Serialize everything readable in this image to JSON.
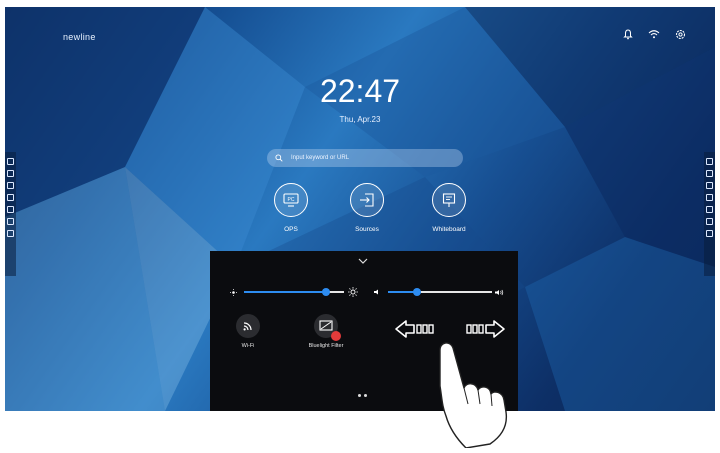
{
  "brand": {
    "logo": "newline"
  },
  "status_bar": {
    "icons": [
      "bell-icon",
      "wifi-icon",
      "settings-icon"
    ]
  },
  "clock": {
    "time": "22:47",
    "date": "Thu, Apr.23"
  },
  "search": {
    "placeholder": "Input keyword or URL"
  },
  "apps": [
    {
      "label": "OPS",
      "icon": "pc-icon"
    },
    {
      "label": "Sources",
      "icon": "source-input-icon"
    },
    {
      "label": "Whiteboard",
      "icon": "whiteboard-icon"
    }
  ],
  "sidebar": {
    "icons": [
      "home-icon",
      "annotate-icon",
      "screenshot-icon",
      "windows-icon",
      "back-icon",
      "apps-icon",
      "multitask-icon"
    ]
  },
  "control_panel": {
    "brightness": {
      "level": 0.82
    },
    "volume": {
      "level": 0.28
    },
    "toggles": [
      {
        "label": "Wi-Fi",
        "icon": "wifi-icon"
      },
      {
        "label": "Bluelight Filter",
        "icon": "bluelight-filter-icon"
      }
    ],
    "swipe_hint": {
      "left_icon": "swipe-left-arrow-icon",
      "right_icon": "swipe-right-arrow-icon"
    },
    "page_indicator": {
      "pages": 2
    }
  },
  "colors": {
    "accent": "#2d8cf0",
    "panel": "#0b0c0f",
    "badge": "#e23b3b"
  }
}
